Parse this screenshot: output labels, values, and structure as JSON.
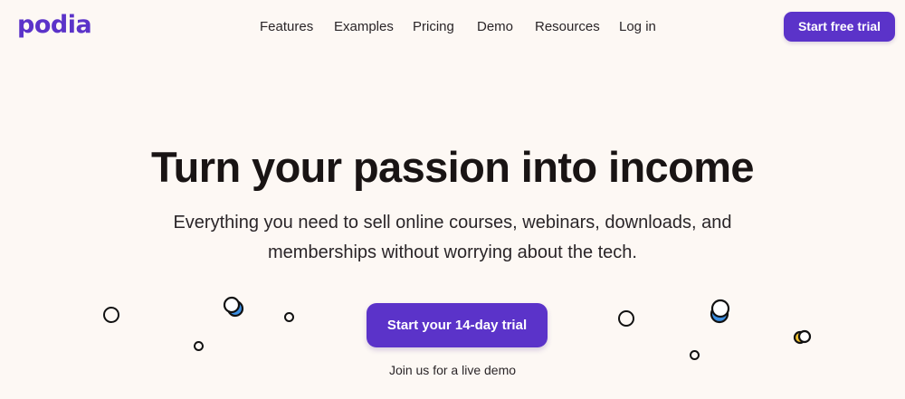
{
  "brand": {
    "logo_text": "podia",
    "accent_color": "#5b33c9",
    "background_color": "#fdf8f4"
  },
  "nav": {
    "items": [
      {
        "label": "Features"
      },
      {
        "label": "Examples"
      },
      {
        "label": "Pricing"
      },
      {
        "label": "Demo"
      },
      {
        "label": "Resources"
      },
      {
        "label": "Log in"
      }
    ],
    "cta_label": "Start free trial"
  },
  "hero": {
    "headline": "Turn your passion into income",
    "subheadline": "Everything you need to sell online courses, webinars, downloads, and memberships without worrying about the tech.",
    "cta_label": "Start your 14-day trial",
    "demo_link": "Join us for a live demo"
  },
  "decorations": {
    "colors": {
      "outline": "#111111",
      "blue": "#3b8fe3",
      "yellow": "#f2c230"
    }
  }
}
